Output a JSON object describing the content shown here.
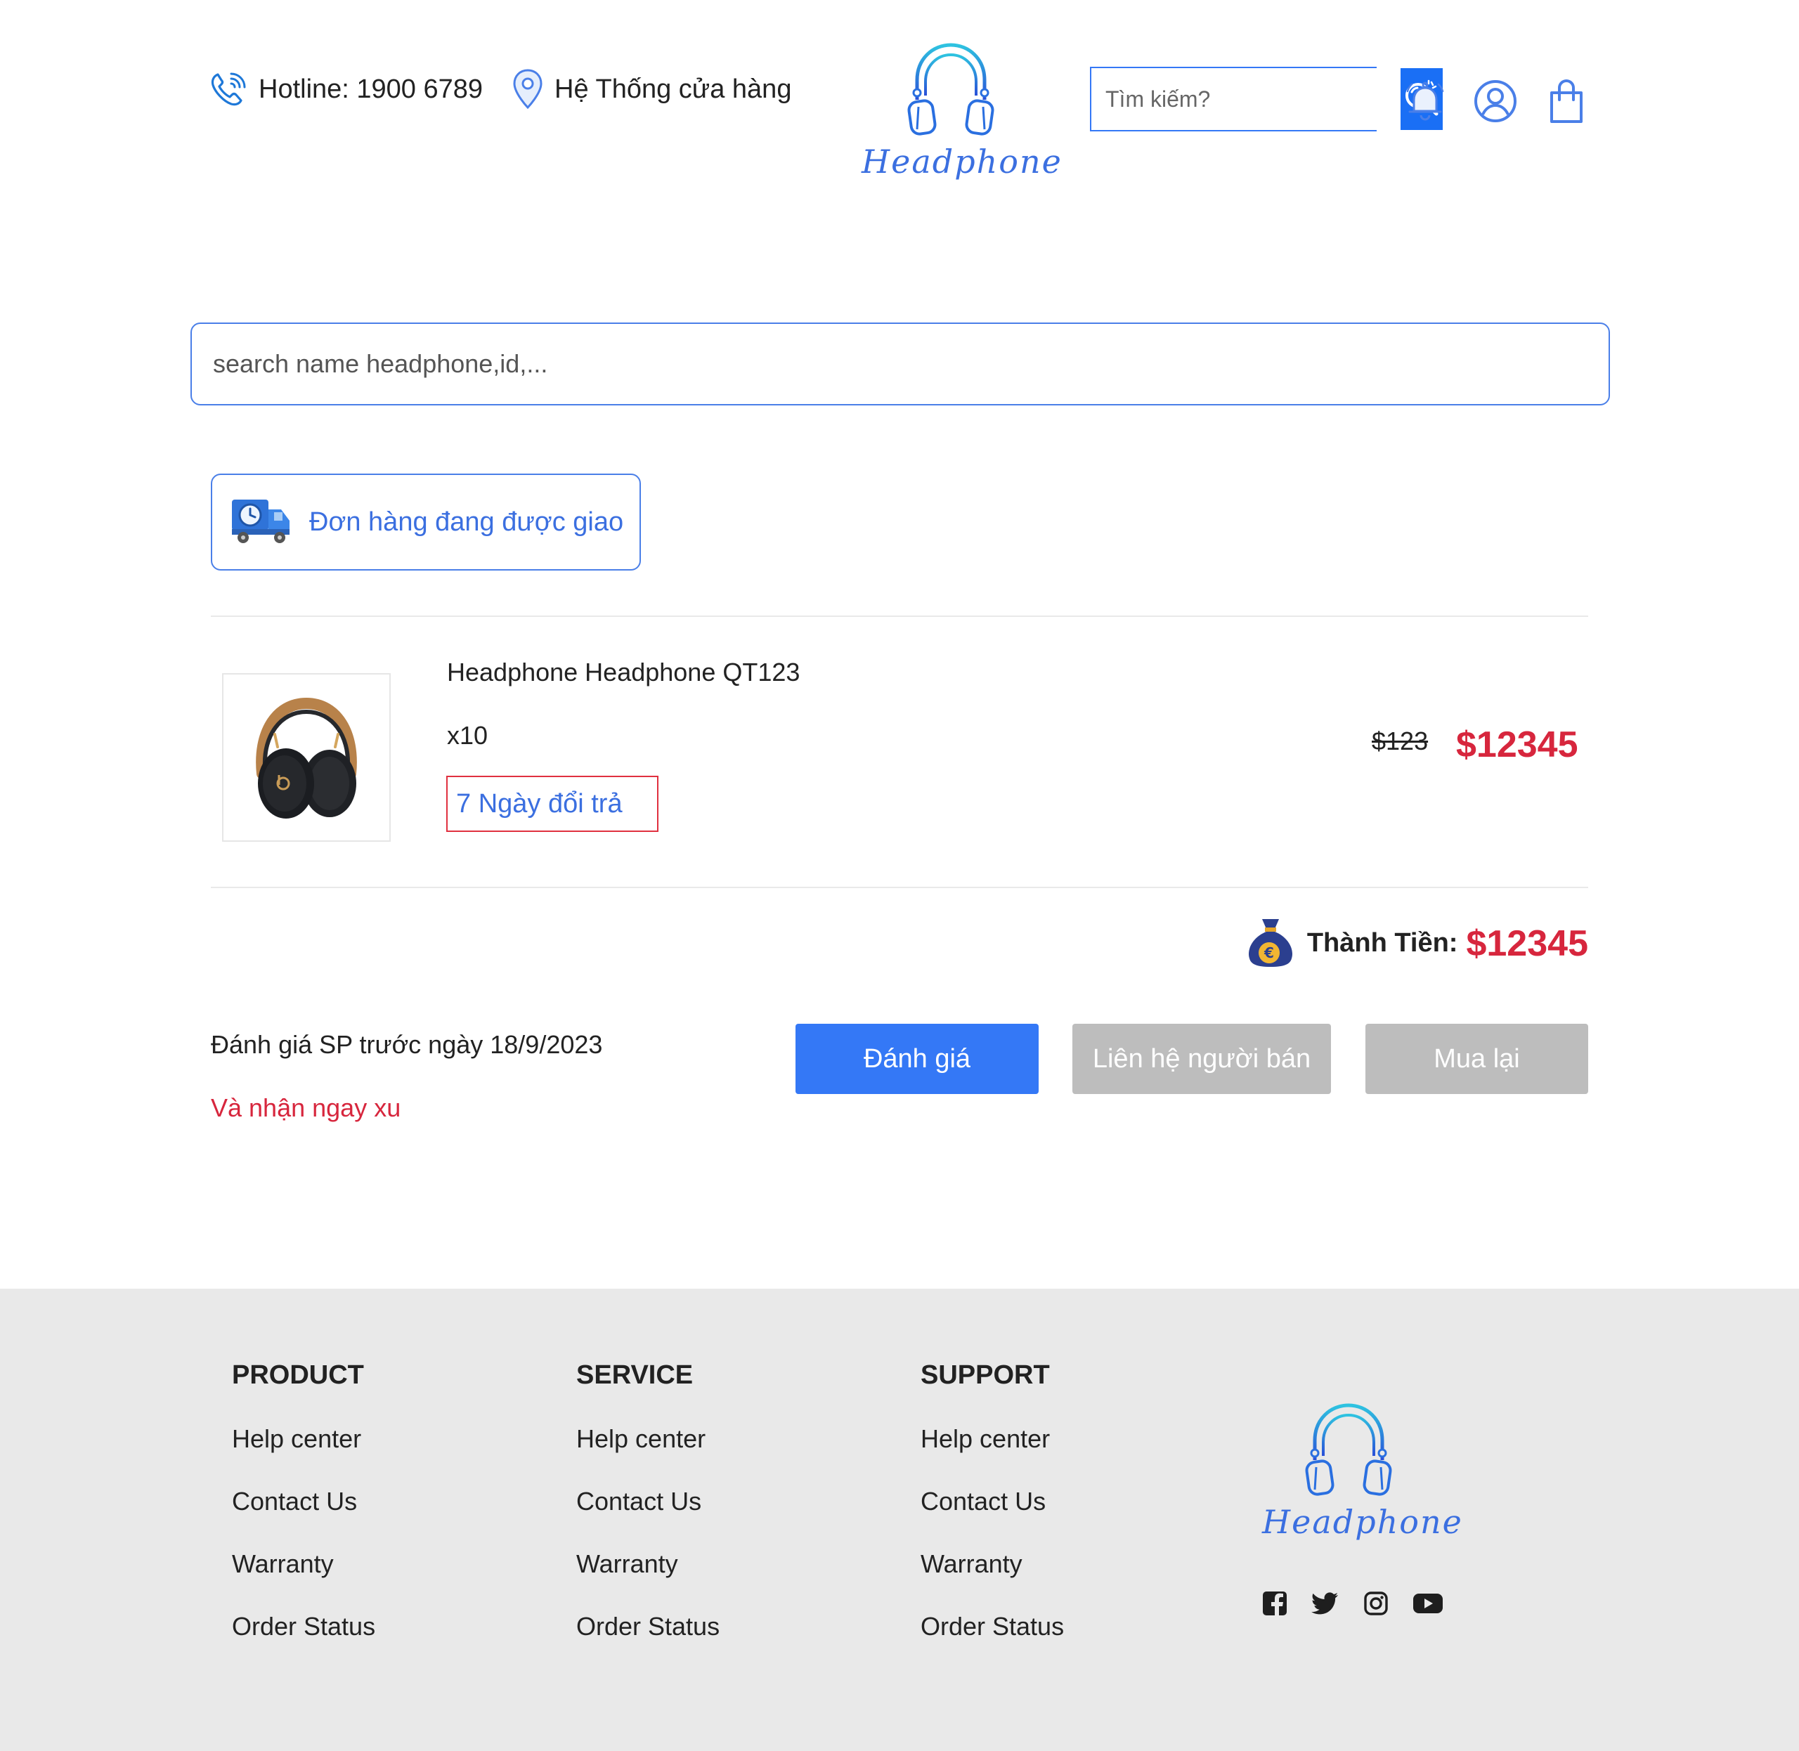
{
  "header": {
    "hotline": "Hotline: 1900 6789",
    "store_system": "Hệ Thống cửa hàng",
    "logo_text": "Headphone",
    "search_placeholder": "Tìm kiếm?"
  },
  "icons": {
    "hotline": "phone-icon",
    "store": "map-pin-icon",
    "search": "search-icon",
    "notifications": "bell-icon",
    "account": "user-icon",
    "cart": "shopping-bag-icon",
    "delivery": "delivery-truck-icon",
    "total": "money-bag-icon"
  },
  "main": {
    "search_placeholder": "search name headphone,id,...",
    "status_tab": "Đơn hàng đang được giao",
    "order": {
      "product_name": "Headphone Headphone QT123",
      "quantity": "x10",
      "return_policy": "7 Ngày đổi trả",
      "price_original": "$123",
      "price_current": "$12345"
    },
    "total_label": "Thành Tiền:",
    "total_value": "$12345",
    "review_note": "Đánh giá SP trước ngày 18/9/2023",
    "review_reward": "Và nhận ngay xu",
    "buttons": {
      "review": "Đánh giá",
      "contact_seller": "Liên hệ người bán",
      "buy_again": "Mua lại"
    }
  },
  "footer": {
    "columns": [
      {
        "title": "PRODUCT",
        "links": [
          "Help center",
          "Contact Us",
          "Warranty",
          "Order Status"
        ]
      },
      {
        "title": "SERVICE",
        "links": [
          "Help center",
          "Contact Us",
          "Warranty",
          "Order Status"
        ]
      },
      {
        "title": "SUPPORT",
        "links": [
          "Help center",
          "Contact Us",
          "Warranty",
          "Order Status"
        ]
      }
    ],
    "logo_text": "Headphone",
    "social": [
      "facebook-icon",
      "twitter-icon",
      "instagram-icon",
      "youtube-icon"
    ]
  },
  "colors": {
    "primary_blue": "#3478f6",
    "price_red": "#d7263d",
    "disabled_gray": "#bdbdbd",
    "footer_bg": "#e9e9e9"
  }
}
